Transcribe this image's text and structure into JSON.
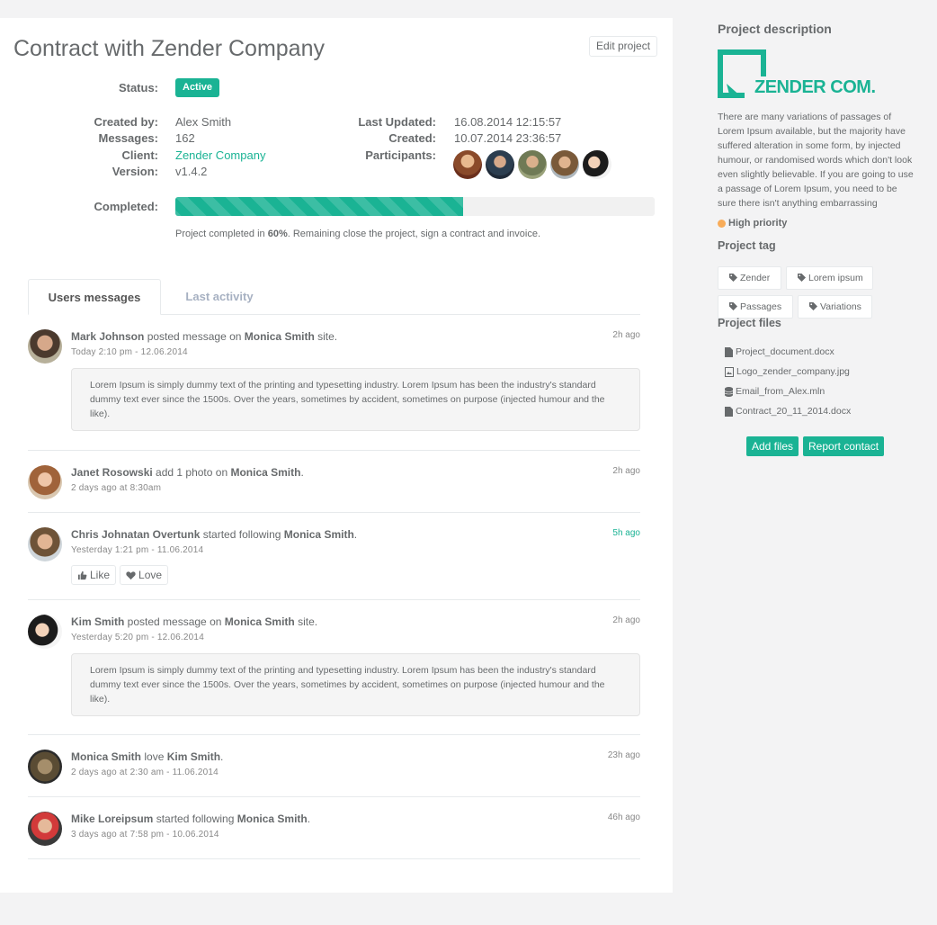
{
  "project": {
    "title": "Contract with Zender Company",
    "edit_label": "Edit project",
    "status_label": "Status:",
    "status_value": "Active",
    "created_by_label": "Created by:",
    "created_by": "Alex Smith",
    "messages_label": "Messages:",
    "messages": "162",
    "client_label": "Client:",
    "client": "Zender Company",
    "version_label": "Version:",
    "version": "v1.4.2",
    "last_updated_label": "Last Updated:",
    "last_updated": "16.08.2014 12:15:57",
    "created_label": "Created:",
    "created": "10.07.2014 23:36:57",
    "participants_label": "Participants:",
    "participants_count": 5,
    "completed_label": "Completed:",
    "completed_percent": 60,
    "note_before": "Project completed in ",
    "note_percent": "60%",
    "note_after": ". Remaining close the project, sign a contract and invoice."
  },
  "tabs": [
    {
      "label": "Users messages",
      "active": true
    },
    {
      "label": "Last activity",
      "active": false
    }
  ],
  "feed": [
    {
      "user": "Mark Johnson",
      "action": " posted message on ",
      "target": "Monica Smith",
      "suffix": " site.",
      "time": "2h ago",
      "date": "Today 2:10 pm - 12.06.2014",
      "message": "Lorem Ipsum is simply dummy text of the printing and typesetting industry. Lorem Ipsum has been the industry's standard dummy text ever since the 1500s. Over the years, sometimes by accident, sometimes on purpose (injected humour and the like)."
    },
    {
      "user": "Janet Rosowski",
      "action": " add 1 photo on ",
      "target": "Monica Smith",
      "suffix": ".",
      "time": "2h ago",
      "date": "2 days ago at 8:30am"
    },
    {
      "user": "Chris Johnatan Overtunk",
      "action": " started following ",
      "target": "Monica Smith",
      "suffix": ".",
      "time": "5h ago",
      "date": "Yesterday 1:21 pm - 11.06.2014",
      "like_label": "Like",
      "love_label": "Love"
    },
    {
      "user": "Kim Smith",
      "action": " posted message on ",
      "target": "Monica Smith",
      "suffix": " site.",
      "time": "2h ago",
      "date": "Yesterday 5:20 pm - 12.06.2014",
      "message": "Lorem Ipsum is simply dummy text of the printing and typesetting industry. Lorem Ipsum has been the industry's standard dummy text ever since the 1500s. Over the years, sometimes by accident, sometimes on purpose (injected humour and the like)."
    },
    {
      "user": "Monica Smith",
      "action": " love ",
      "target": "Kim Smith",
      "suffix": ".",
      "time": "23h ago",
      "date": "2 days ago at 2:30 am - 11.06.2014"
    },
    {
      "user": "Mike Loreipsum",
      "action": " started following ",
      "target": "Monica Smith",
      "suffix": ".",
      "time": "46h ago",
      "date": "3 days ago at 7:58 pm - 10.06.2014"
    }
  ],
  "sidebar": {
    "description_title": "Project description",
    "logo_text": "ZENDER COM.",
    "description": "There are many variations of passages of Lorem Ipsum available, but the majority have suffered alteration in some form, by injected humour, or randomised words which don't look even slightly believable. If you are going to use a passage of Lorem Ipsum, you need to be sure there isn't anything embarrassing",
    "priority": "High priority",
    "tag_title": "Project tag",
    "tags": [
      "Zender",
      "Lorem ipsum",
      "Passages",
      "Variations"
    ],
    "files_title": "Project files",
    "files": [
      "Project_document.docx",
      "Logo_zender_company.jpg",
      "Email_from_Alex.mln",
      "Contract_20_11_2014.docx"
    ],
    "add_files": "Add files",
    "report_contact": "Report contact"
  },
  "colors": {
    "accent": "#1ab394",
    "priority": "#f8ac59",
    "background": "#f3f3f4"
  }
}
